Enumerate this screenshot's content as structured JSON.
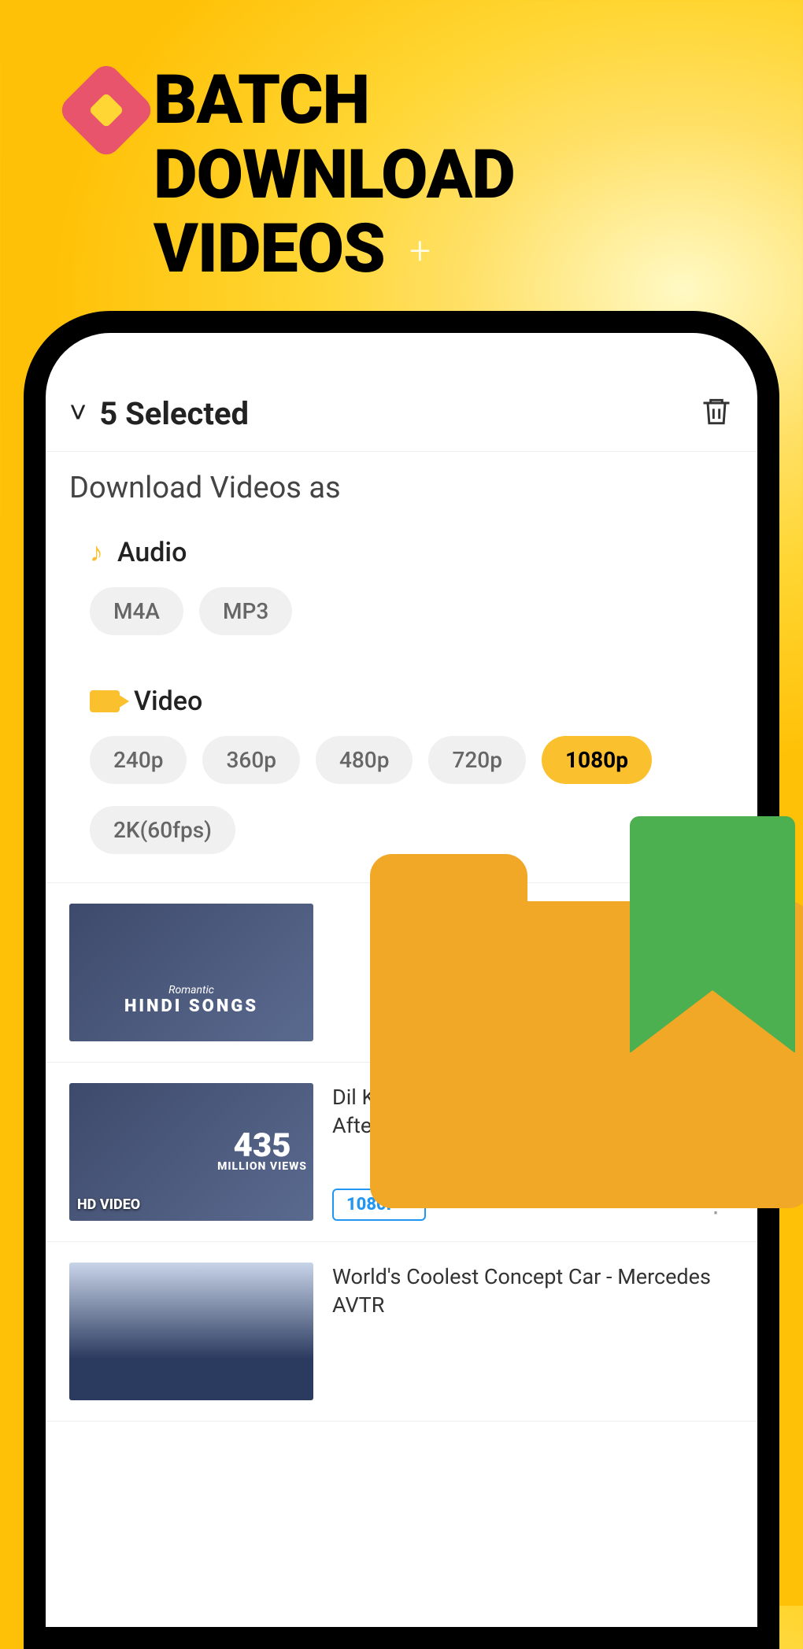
{
  "hero": {
    "title_line1": "BATCH",
    "title_line2": "DOWNLOAD",
    "title_line3": "VIDEOS"
  },
  "header": {
    "selected_text": "5 Selected"
  },
  "section": {
    "title": "Download Videos as",
    "audio_label": "Audio",
    "video_label": "Video"
  },
  "audio_formats": [
    "M4A",
    "MP3"
  ],
  "video_formats": [
    {
      "label": "240p",
      "active": false
    },
    {
      "label": "360p",
      "active": false
    },
    {
      "label": "480p",
      "active": false
    },
    {
      "label": "720p",
      "active": false
    },
    {
      "label": "1080p",
      "active": true
    },
    {
      "label": "2K(60fps)",
      "active": false
    }
  ],
  "videos": [
    {
      "thumb_label": "HINDI SONGS",
      "thumb_prefix": "Romantic",
      "title": "",
      "quality": ""
    },
    {
      "thumb_label": "HD VIDEO",
      "views_num": "435",
      "views_txt": "MILLION VIEWS",
      "title": "Dil Ko Karaar aaya (Mashup) | Aftermorning | Sidharth Shukla & Ne...",
      "quality": "1080P"
    },
    {
      "title": "World's Coolest Concept Car - Mercedes AVTR",
      "quality": ""
    }
  ]
}
